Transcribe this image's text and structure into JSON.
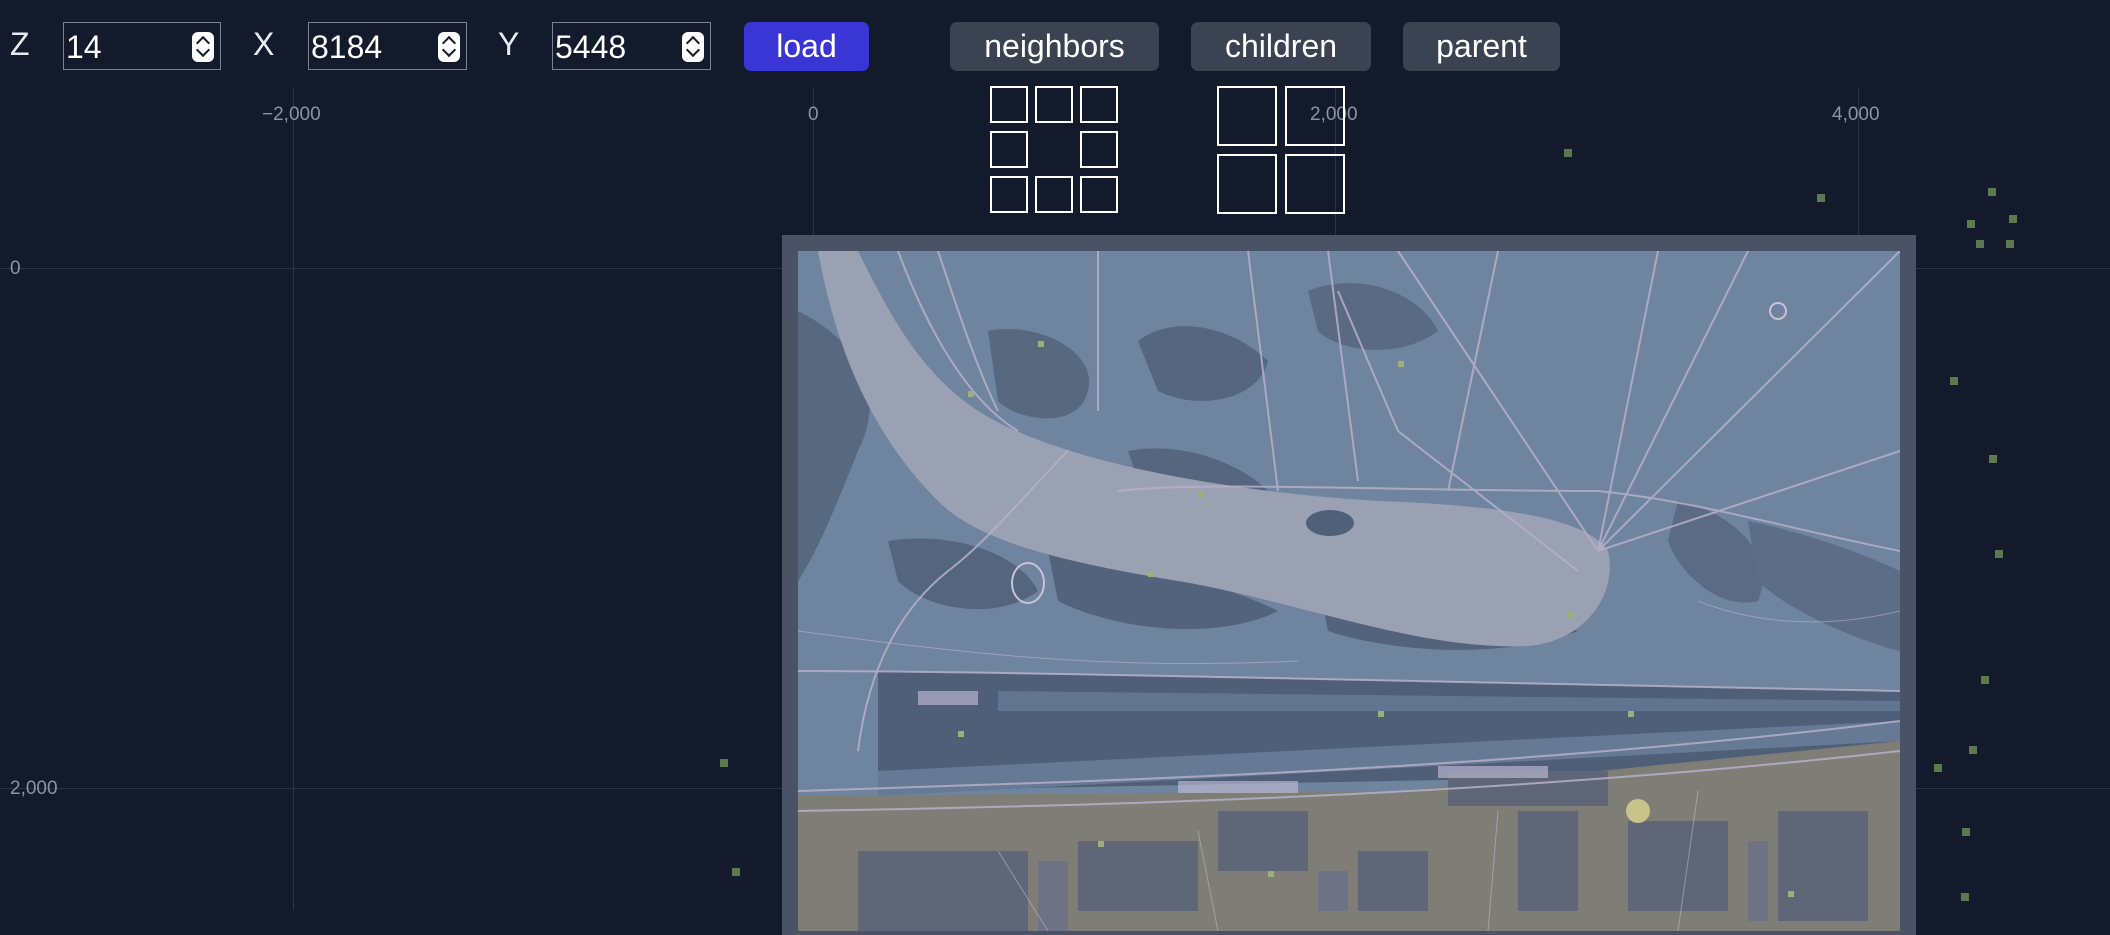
{
  "controls": {
    "z": {
      "label": "Z",
      "value": "14"
    },
    "x": {
      "label": "X",
      "value": "8184"
    },
    "y": {
      "label": "Y",
      "value": "5448"
    },
    "load_label": "load",
    "neighbors_label": "neighbors",
    "children_label": "children",
    "parent_label": "parent"
  },
  "axes": {
    "x_ticks": [
      "−2,000",
      "0",
      "2,000",
      "4,000"
    ],
    "y_ticks": [
      "0",
      "2,000"
    ]
  },
  "colors": {
    "background": "#131a2b",
    "accent": "#3a36d6",
    "button": "#3b4352",
    "tile_land": "#6f849f",
    "tile_water": "#9aa1b3",
    "tile_dark": "#50607a",
    "tile_urban": "#8a8a80"
  },
  "icons": [
    "neighbors-grid-icon",
    "children-grid-icon"
  ]
}
